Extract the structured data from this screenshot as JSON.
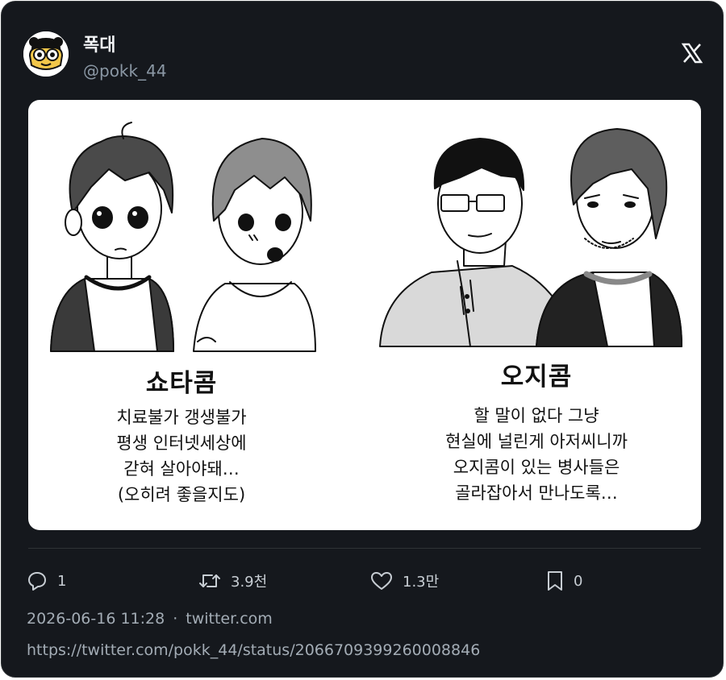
{
  "tweet": {
    "author_name": "폭대",
    "author_handle": "@pokk_44",
    "platform_icon": "x-logo-icon",
    "avatar_icon": "cartoon-avatar-icon"
  },
  "comic": {
    "left": {
      "title": "쇼타콤",
      "lines": [
        "치료불가 갱생불가",
        "평생 인터넷세상에",
        "갇혀 살아야돼…",
        "(오히려 좋을지도)"
      ]
    },
    "right": {
      "title": "오지콤",
      "lines": [
        "할 말이 없다 그냥",
        "현실에 널린게 아저씨니까",
        "오지콤이 있는 병사들은",
        "골라잡아서 만나도록…"
      ]
    }
  },
  "actions": {
    "replies": "1",
    "retweets": "3.9천",
    "likes": "1.3만",
    "bookmarks": "0"
  },
  "meta": {
    "timestamp": "2026-06-16 11:28",
    "separator": "·",
    "source": "twitter.com",
    "url": "https://twitter.com/pokk_44/status/2066709399260008846"
  },
  "colors": {
    "card_bg": "#15181d",
    "text_primary": "#f2f4f6",
    "text_secondary": "#8b98a5"
  }
}
